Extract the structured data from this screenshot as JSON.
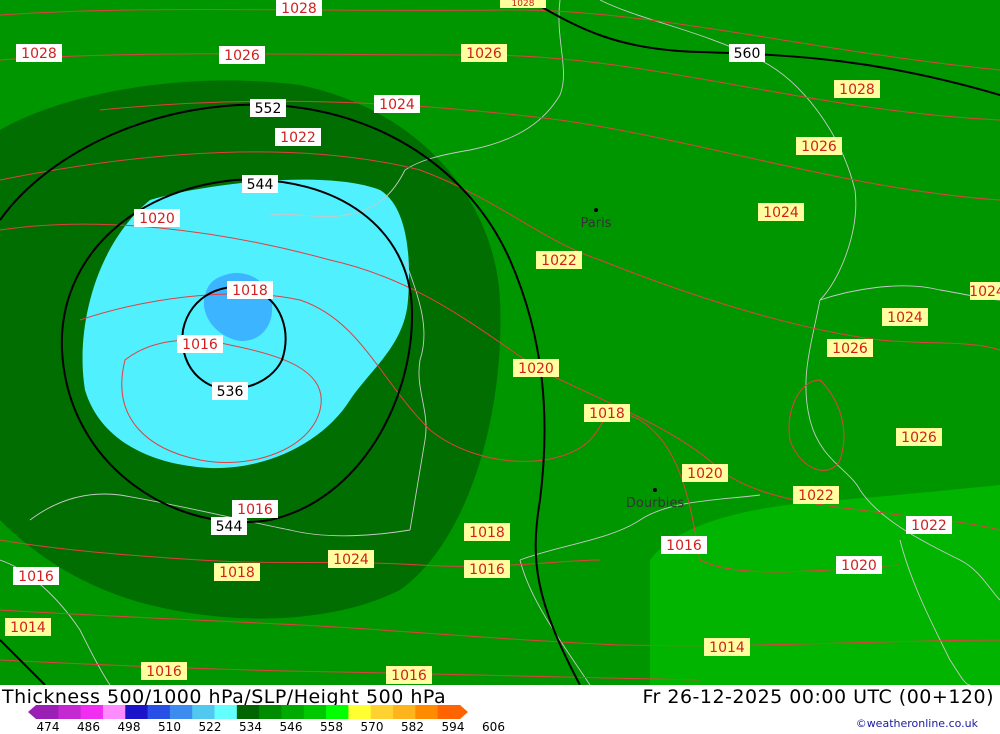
{
  "title": "Thickness 500/1000 hPa/SLP/Height 500 hPa",
  "timestamp": "Fr 26-12-2025 00:00 UTC (00+120)",
  "credit": "©weatheronline.co.uk",
  "cities": [
    {
      "name": "Paris"
    },
    {
      "name": "Dourbies"
    }
  ],
  "thickness_labels": [
    "536",
    "544",
    "544",
    "552",
    "560"
  ],
  "slp_labels": [
    "1028",
    "1028",
    "1026",
    "1026",
    "1024",
    "1022",
    "1020",
    "1018",
    "1016",
    "1016",
    "1028",
    "1026",
    "1024",
    "1022",
    "1020",
    "1018",
    "1018",
    "1016",
    "1016",
    "1014",
    "1016",
    "1016",
    "1018",
    "1020",
    "1022",
    "1016",
    "1014",
    "1028",
    "1026",
    "1024",
    "1026",
    "1024",
    "1024",
    "1022",
    "1020",
    "1018",
    "1026"
  ],
  "legend": {
    "ticks": [
      "474",
      "486",
      "498",
      "510",
      "522",
      "534",
      "546",
      "558",
      "570",
      "582",
      "594",
      "606"
    ],
    "colors": [
      "#9a1fb5",
      "#c428d0",
      "#f02df0",
      "#ff8cff",
      "#1c14c8",
      "#2850e6",
      "#3c8cf0",
      "#50c8f0",
      "#64ffff",
      "#006400",
      "#008c00",
      "#00aa00",
      "#00c800",
      "#00ff00",
      "#ffff32",
      "#ffd232",
      "#ffb41e",
      "#ff8c00",
      "#ff6400"
    ]
  }
}
